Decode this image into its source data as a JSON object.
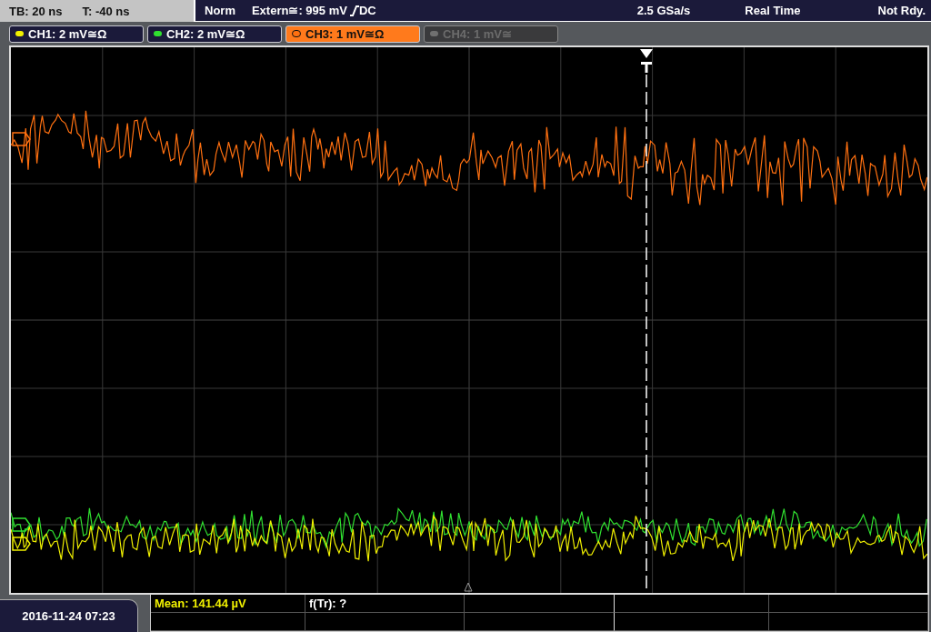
{
  "header": {
    "timebase": "TB: 20 ns",
    "trigger_time": "T: -40 ns",
    "trigger_mode": "Norm",
    "trigger_source": "Extern≅: 995 mV",
    "trigger_coupling": "DC",
    "sample_rate": "2.5 GSa/s",
    "acquisition": "Real Time",
    "status": "Not Rdy."
  },
  "channels": [
    {
      "label": "CH1: 2 mV≅Ω",
      "color": "#f0f000",
      "selected": false,
      "enabled": true
    },
    {
      "label": "CH2: 2 mV≅Ω",
      "color": "#30e030",
      "selected": false,
      "enabled": true
    },
    {
      "label": "CH3: 1 mV≅Ω",
      "color": "#ff7010",
      "selected": true,
      "enabled": true
    },
    {
      "label": "CH4: 1 mV≅",
      "color": "#707070",
      "selected": false,
      "enabled": false
    }
  ],
  "measurements": [
    {
      "label": "Mean: 141.44 µV",
      "color": "#f0f000"
    },
    {
      "label": "f(Tr): ?",
      "color": "#ffffff"
    }
  ],
  "date": "2016-11-24 07:23"
}
